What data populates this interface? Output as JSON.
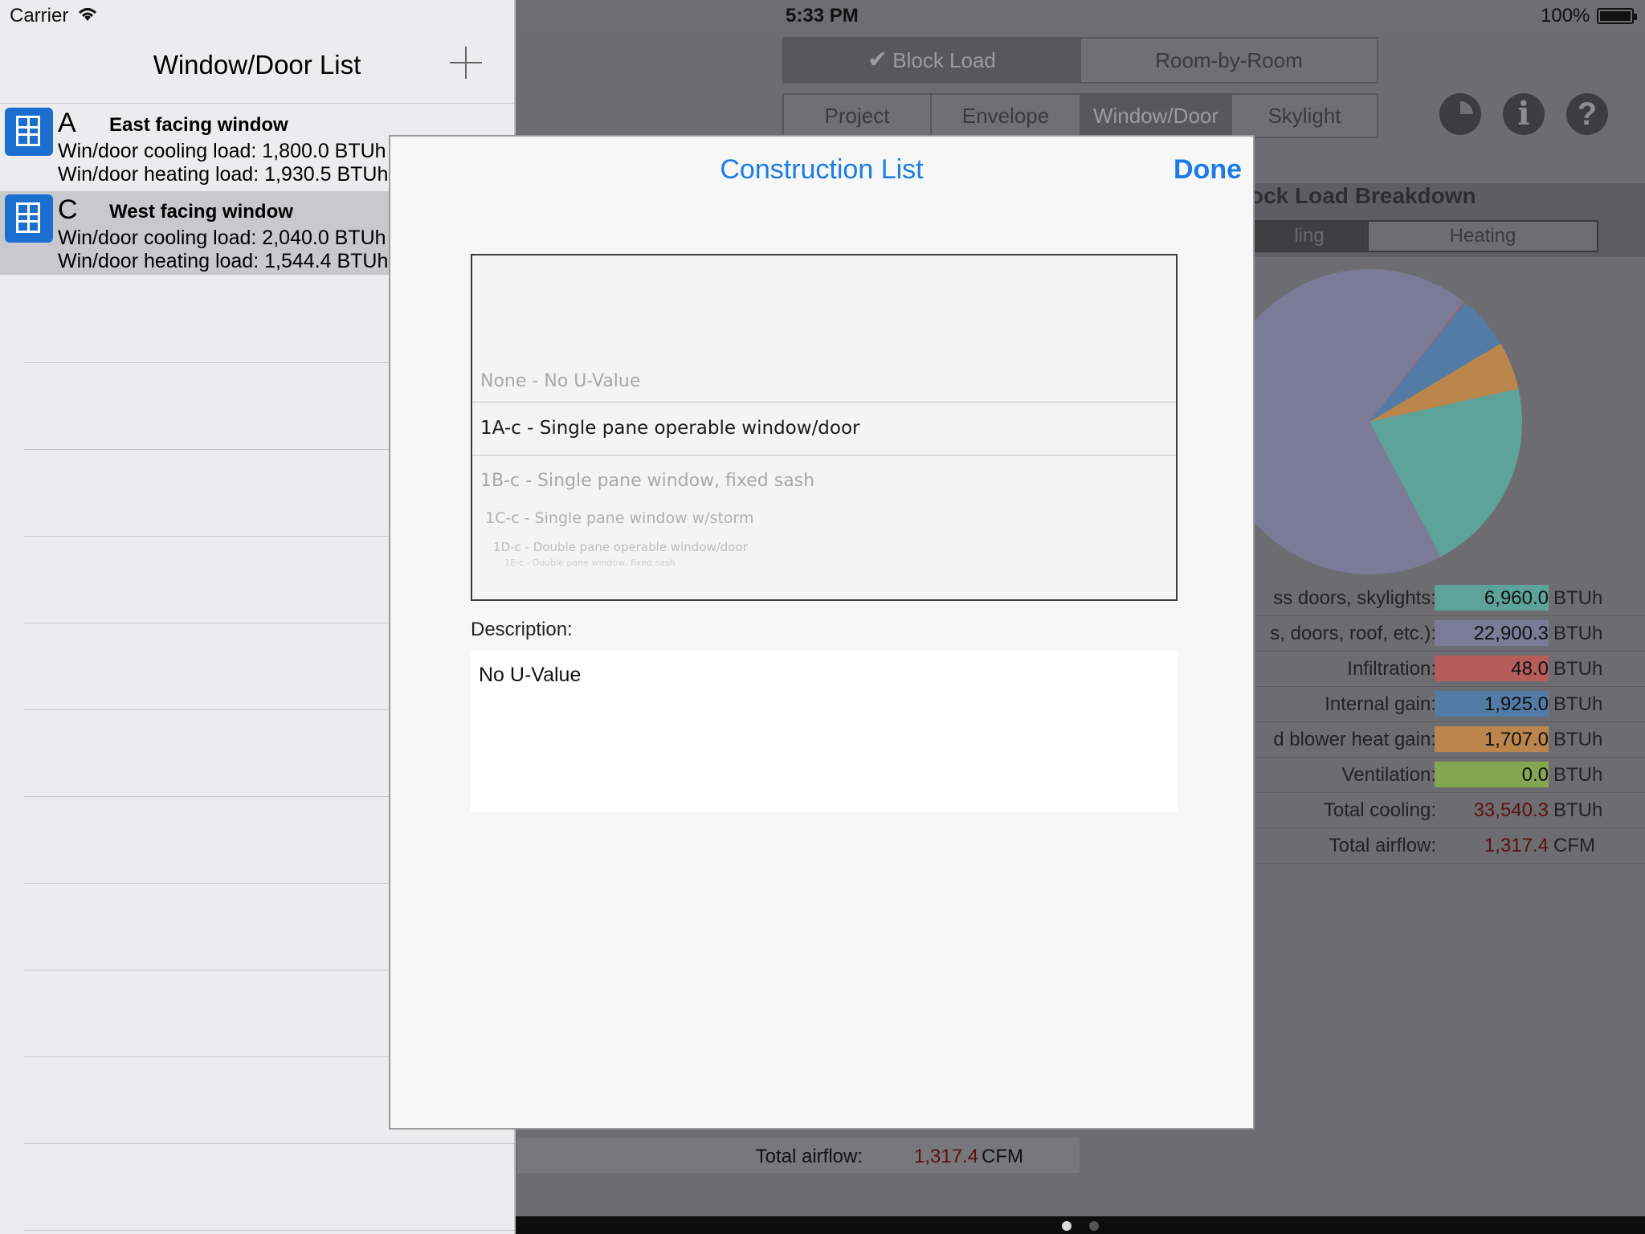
{
  "status": {
    "carrier": "Carrier",
    "time": "5:33 PM",
    "battery": "100%"
  },
  "master": {
    "title": "Window/Door List",
    "rows": [
      {
        "letter": "A",
        "title": "East facing window",
        "line1": "Win/door cooling load: 1,800.0 BTUh",
        "line2": "Win/door heating load: 1,930.5 BTUh"
      },
      {
        "letter": "C",
        "title": "West facing window",
        "line1": "Win/door cooling load: 2,040.0 BTUh",
        "line2": "Win/door heating load: 1,544.4 BTUh"
      }
    ]
  },
  "detail": {
    "mode_tabs": [
      "Block Load",
      "Room-by-Room"
    ],
    "section_tabs": [
      "Project",
      "Envelope",
      "Window/Door",
      "Skylight"
    ],
    "breakdown_title": "ock Load Breakdown",
    "breakdown_tabs": [
      "ling",
      "Heating"
    ],
    "legend": [
      {
        "label": "ss doors, skylights:",
        "value": "6,960.0",
        "unit": "BTUh",
        "color": "#5bada0"
      },
      {
        "label": "s, doors, roof, etc.):",
        "value": "22,900.3",
        "unit": "BTUh",
        "color": "#7e7e9e"
      },
      {
        "label": "Infiltration:",
        "value": "48.0",
        "unit": "BTUh",
        "color": "#c25a57"
      },
      {
        "label": "Internal gain:",
        "value": "1,925.0",
        "unit": "BTUh",
        "color": "#4e7fae"
      },
      {
        "label": "d blower heat gain:",
        "value": "1,707.0",
        "unit": "BTUh",
        "color": "#c98b45"
      },
      {
        "label": "Ventilation:",
        "value": "0.0",
        "unit": "BTUh",
        "color": "#88b04b"
      }
    ],
    "total_cooling": {
      "label": "Total cooling:",
      "value": "33,540.3",
      "unit": "BTUh"
    },
    "total_airflow": {
      "label": "Total airflow:",
      "value": "1,317.4",
      "unit": "CFM"
    },
    "bottom_airflow": {
      "label": "Total airflow:",
      "value": "1,317.4",
      "unit": "CFM"
    }
  },
  "pie_chart": {
    "type": "pie",
    "slices": [
      {
        "name": "Windows, glass doors, skylights",
        "value": 6960.0,
        "color": "#5bada0"
      },
      {
        "name": "Walls, doors, roof, etc.",
        "value": 22900.3,
        "color": "#7e7e9e"
      },
      {
        "name": "Infiltration",
        "value": 48.0,
        "color": "#c25a57"
      },
      {
        "name": "Internal gain",
        "value": 1925.0,
        "color": "#4e7fae"
      },
      {
        "name": "Duct and blower heat gain",
        "value": 1707.0,
        "color": "#c98b45"
      },
      {
        "name": "Ventilation",
        "value": 0.0,
        "color": "#88b04b"
      }
    ]
  },
  "modal": {
    "title": "Construction List",
    "done": "Done",
    "picker_items": [
      "None - No U-Value",
      "1A-c - Single pane operable window/door",
      "1B-c - Single pane window, fixed sash",
      "1C-c - Single pane window w/storm",
      "1D-c - Double pane operable window/door",
      "1E-c - Double pane window, fixed sash"
    ],
    "description_label": "Description:",
    "description": "No U-Value"
  }
}
